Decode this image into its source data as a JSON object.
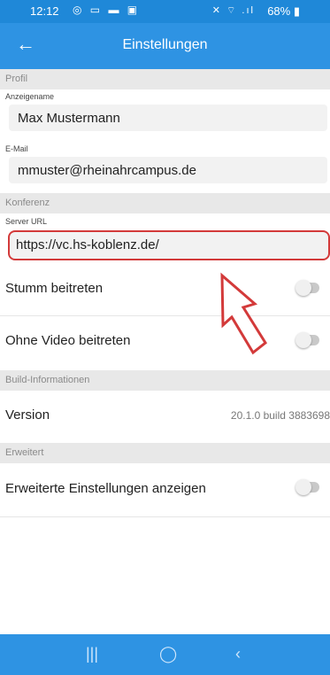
{
  "status_bar": {
    "time": "12:12",
    "left_icons": "◎ ▭ ▬ ▣",
    "right_icons": "✕ ⌔ .ıl",
    "battery": "68% ▮"
  },
  "app_bar": {
    "back_icon": "←",
    "title": "Einstellungen"
  },
  "profile": {
    "section_title": "Profil",
    "display_name_label": "Anzeigename",
    "display_name_value": "Max Mustermann",
    "email_label": "E-Mail",
    "email_value": "mmuster@rheinahrcampus.de"
  },
  "conference": {
    "section_title": "Konferenz",
    "server_url_label": "Server URL",
    "server_url_value": "https://vc.hs-koblenz.de/",
    "mute_label": "Stumm beitreten",
    "mute_on": false,
    "no_video_label": "Ohne Video beitreten",
    "no_video_on": false
  },
  "build": {
    "section_title": "Build-Informationen",
    "version_label": "Version",
    "version_value": "20.1.0 build 3883698"
  },
  "advanced": {
    "section_title": "Erweitert",
    "show_advanced_label": "Erweiterte Einstellungen anzeigen",
    "show_advanced_on": false
  },
  "nav_bar": {
    "recents_icon": "|||",
    "home_icon": "◯",
    "back_icon": "‹"
  },
  "colors": {
    "status_bar": "#1f88d8",
    "app_bar": "#2e93e3",
    "highlight_border": "#d33a3a",
    "arrow": "#d33a3a"
  }
}
